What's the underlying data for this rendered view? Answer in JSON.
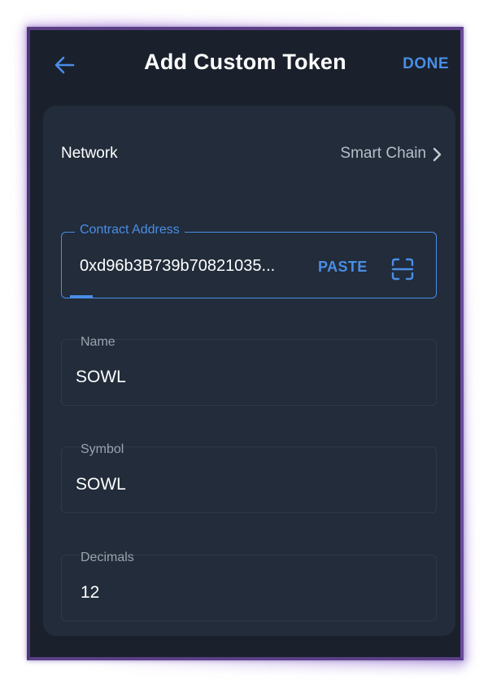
{
  "header": {
    "title": "Add Custom Token",
    "done_label": "DONE",
    "back_icon": "arrow-left-icon"
  },
  "network": {
    "label": "Network",
    "value": "Smart Chain",
    "chevron_icon": "chevron-right-icon"
  },
  "contract_address": {
    "label": "Contract Address",
    "value": "0xd96b3B739b70821035...",
    "paste_label": "PASTE",
    "scan_icon": "qr-scan-icon"
  },
  "name": {
    "label": "Name",
    "value": "SOWL"
  },
  "symbol": {
    "label": "Symbol",
    "value": "SOWL"
  },
  "decimals": {
    "label": "Decimals",
    "value": "12"
  },
  "colors": {
    "background": "#1a212c",
    "card": "#222c3a",
    "accent": "#4a8ee6",
    "frame": "#5b3f86"
  }
}
